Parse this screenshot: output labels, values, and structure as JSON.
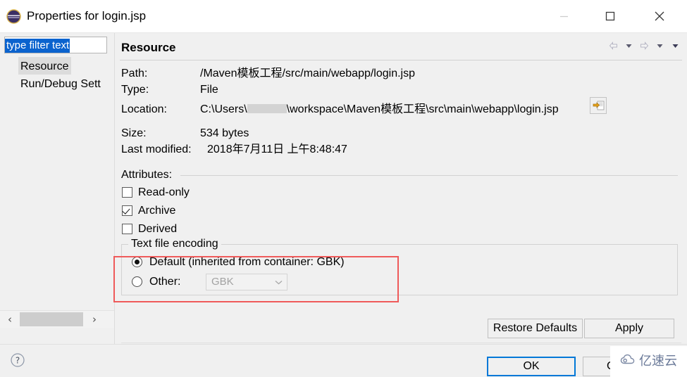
{
  "window": {
    "title": "Properties for login.jsp",
    "icon": "eclipse-logo",
    "minimize_label": "–",
    "maximize_label": "□",
    "close_label": "✕"
  },
  "sidebar": {
    "filter": {
      "value": "type filter text",
      "placeholder": "type filter text"
    },
    "items": [
      {
        "label": "Resource",
        "selected": true
      },
      {
        "label": "Run/Debug Sett",
        "selected": false
      }
    ],
    "scrollbar": {
      "left_arrow": "‹",
      "right_arrow": "›"
    }
  },
  "page": {
    "title": "Resource",
    "nav": {
      "back": "back-arrow",
      "back_menu": "chevron-down",
      "forward": "forward-arrow",
      "forward_menu": "chevron-down",
      "more_menu": "chevron-down"
    },
    "info": [
      {
        "label": "Path:",
        "value": "/Maven模板工程/src/main/webapp/login.jsp"
      },
      {
        "label": "Type:",
        "value": "File"
      },
      {
        "label": "Location:",
        "value_prefix": "C:\\Users\\",
        "value_suffix": "\\workspace\\Maven模板工程\\src\\main\\webapp\\login.jsp",
        "redacted": true,
        "button_icon": "browse-location-icon"
      },
      {
        "label": "Size:",
        "value": "534  bytes"
      },
      {
        "label": "Last modified:",
        "value": "2018年7月11日 上午8:48:47"
      }
    ],
    "attributes": {
      "heading": "Attributes:",
      "checkboxes": [
        {
          "label": "Read-only",
          "checked": false
        },
        {
          "label": "Archive",
          "checked": true
        },
        {
          "label": "Derived",
          "checked": false
        }
      ]
    },
    "encoding": {
      "legend": "Text file encoding",
      "default_option": "Default (inherited from container: GBK)",
      "default_selected": true,
      "other_option": "Other:",
      "other_selected": false,
      "other_value": "GBK",
      "other_disabled": true,
      "highlight_color": "#ef5a5a"
    },
    "buttons": {
      "restore_defaults": "Restore Defaults",
      "apply": "Apply"
    }
  },
  "footer": {
    "help_icon": "help-question-icon",
    "ok": "OK",
    "cancel": "Ca"
  },
  "watermark": {
    "text": "亿速云",
    "icon": "cloud-logo",
    "color": "#6b7a99"
  }
}
